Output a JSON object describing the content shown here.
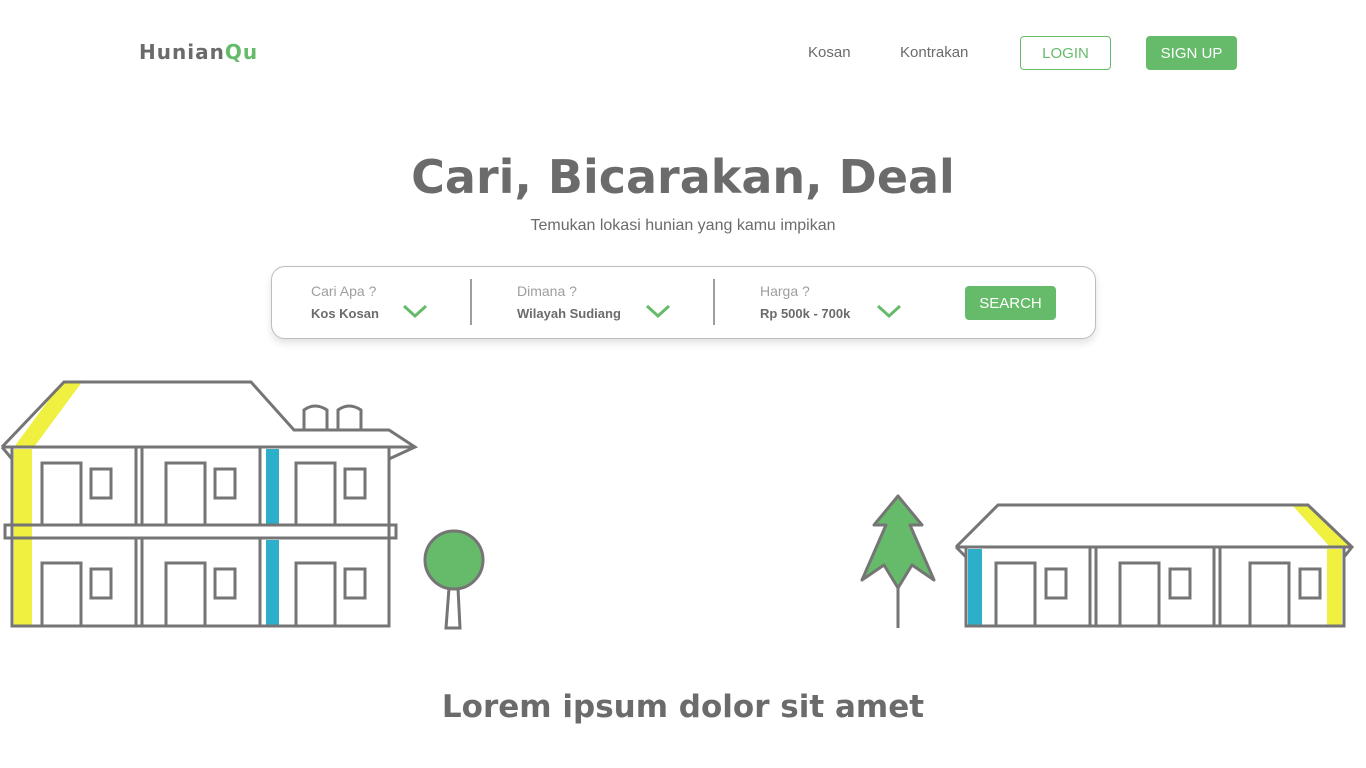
{
  "nav": {
    "logo_main": "Hunian",
    "logo_accent": "Qu",
    "links": [
      "Kosan",
      "Kontrakan"
    ],
    "login_label": "LOGIN",
    "signup_label": "SIGN UP"
  },
  "hero": {
    "title": "Cari, Bicarakan, Deal",
    "subtitle": "Temukan lokasi hunian yang kamu impikan"
  },
  "search": {
    "fields": [
      {
        "label": "Cari Apa ?",
        "value": "Kos Kosan"
      },
      {
        "label": "Dimana ?",
        "value": "Wilayah Sudiang"
      },
      {
        "label": "Harga ?",
        "value": "Rp 500k - 700k"
      }
    ],
    "button_label": "SEARCH",
    "chevron_icon": "chevron-down-icon"
  },
  "section": {
    "title": "Lorem ipsum dolor sit amet"
  },
  "colors": {
    "accent": "#66bb6a",
    "text": "#6b6b6b",
    "yellow": "#f0f040",
    "blue": "#2eafc9"
  }
}
